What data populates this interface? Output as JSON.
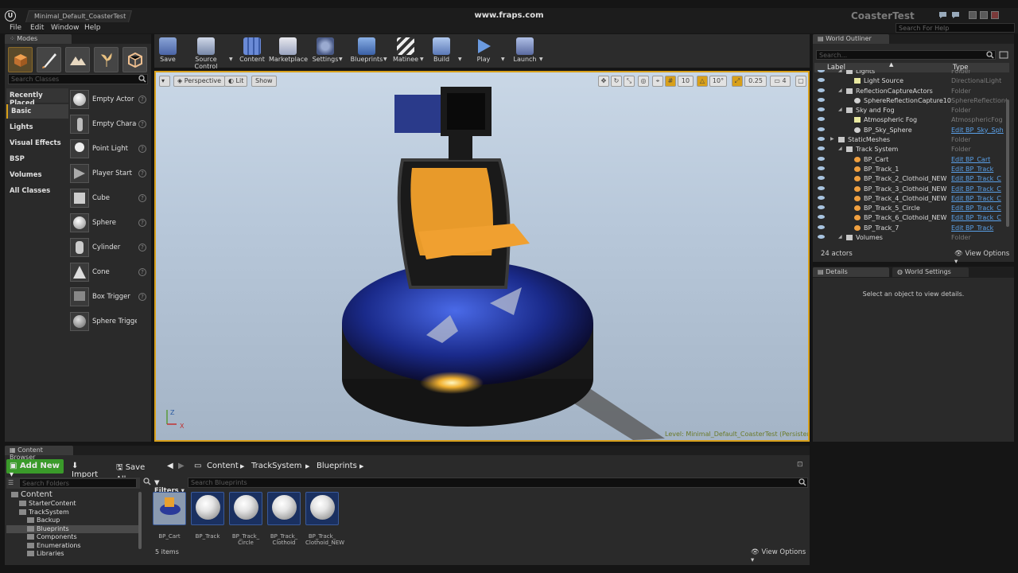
{
  "titlebar": {
    "doc_tab": "Minimal_Default_CoasterTest",
    "overlay": "www.fraps.com",
    "project": "CoasterTest"
  },
  "menu": {
    "items": [
      "File",
      "Edit",
      "Window",
      "Help"
    ],
    "help_search_placeholder": "Search For Help"
  },
  "modes": {
    "tab_label": "Modes",
    "search_placeholder": "Search Classes",
    "categories": [
      "Recently Placed",
      "Basic",
      "Lights",
      "Visual Effects",
      "BSP",
      "Volumes",
      "All Classes"
    ],
    "items": [
      "Empty Actor",
      "Empty Charac",
      "Point Light",
      "Player Start",
      "Cube",
      "Sphere",
      "Cylinder",
      "Cone",
      "Box Trigger",
      "Sphere Trigge"
    ]
  },
  "toolbar": {
    "buttons": [
      "Save",
      "Source Control",
      "Content",
      "Marketplace",
      "Settings",
      "Blueprints",
      "Matinee",
      "Build",
      "Play",
      "Launch"
    ]
  },
  "viewport": {
    "perspective": "Perspective",
    "lit": "Lit",
    "show": "Show",
    "grid_snap": "10",
    "rot_snap": "10°",
    "scale_snap": "0.25",
    "cam_speed": "4",
    "level_label": "Level:  Minimal_Default_CoasterTest (Persistent)",
    "axis_z": "Z",
    "axis_x": "X"
  },
  "outliner": {
    "tab_label": "World Outliner",
    "search_placeholder": "Search...",
    "col_label": "Label",
    "col_type": "Type",
    "rows": [
      {
        "label": "Lights",
        "type": "Folder",
        "indent": 1,
        "kind": "folder",
        "link": false
      },
      {
        "label": "Light Source",
        "type": "DirectionalLight",
        "indent": 2,
        "kind": "light",
        "link": false
      },
      {
        "label": "ReflectionCaptureActors",
        "type": "Folder",
        "indent": 1,
        "kind": "folder",
        "link": false
      },
      {
        "label": "SphereReflectionCapture10",
        "type": "SphereReflectionC",
        "indent": 2,
        "kind": "sphere",
        "link": false
      },
      {
        "label": "Sky and Fog",
        "type": "Folder",
        "indent": 1,
        "kind": "folder",
        "link": false
      },
      {
        "label": "Atmospheric Fog",
        "type": "AtmosphericFog",
        "indent": 2,
        "kind": "light",
        "link": false
      },
      {
        "label": "BP_Sky_Sphere",
        "type": "Edit BP_Sky_Sph",
        "indent": 2,
        "kind": "sphere",
        "link": true
      },
      {
        "label": "StaticMeshes",
        "type": "Folder",
        "indent": 0,
        "kind": "folder",
        "link": false
      },
      {
        "label": "Track System",
        "type": "Folder",
        "indent": 1,
        "kind": "folder",
        "link": false
      },
      {
        "label": "BP_Cart",
        "type": "Edit BP_Cart",
        "indent": 2,
        "kind": "bp",
        "link": true
      },
      {
        "label": "BP_Track_1",
        "type": "Edit BP_Track",
        "indent": 2,
        "kind": "bp",
        "link": true
      },
      {
        "label": "BP_Track_2_Clothoid_NEW",
        "type": "Edit BP_Track_C",
        "indent": 2,
        "kind": "bp",
        "link": true
      },
      {
        "label": "BP_Track_3_Clothoid_NEW",
        "type": "Edit BP_Track_C",
        "indent": 2,
        "kind": "bp",
        "link": true
      },
      {
        "label": "BP_Track_4_Clothoid_NEW",
        "type": "Edit BP_Track_C",
        "indent": 2,
        "kind": "bp",
        "link": true
      },
      {
        "label": "BP_Track_5_Circle",
        "type": "Edit BP_Track_C",
        "indent": 2,
        "kind": "bp",
        "link": true
      },
      {
        "label": "BP_Track_6_Clothoid_NEW",
        "type": "Edit BP_Track_C",
        "indent": 2,
        "kind": "bp",
        "link": true
      },
      {
        "label": "BP_Track_7",
        "type": "Edit BP_Track",
        "indent": 2,
        "kind": "bp",
        "link": true
      },
      {
        "label": "Volumes",
        "type": "Folder",
        "indent": 1,
        "kind": "folder",
        "link": false
      }
    ],
    "actor_count": "24 actors",
    "view_options": "View Options"
  },
  "details": {
    "tab_details": "Details",
    "tab_world_settings": "World Settings",
    "empty_message": "Select an object to view details."
  },
  "content_browser": {
    "tab_label": "Content Browser",
    "add_new": "Add New",
    "import": "Import",
    "save_all": "Save All",
    "path": [
      "Content",
      "TrackSystem",
      "Blueprints"
    ],
    "search_folders_placeholder": "Search Folders",
    "filters": "Filters",
    "search_blueprints_placeholder": "Search Blueprints",
    "tree": [
      {
        "label": "Content",
        "indent": 0,
        "selected": false
      },
      {
        "label": "StarterContent",
        "indent": 1,
        "selected": false
      },
      {
        "label": "TrackSystem",
        "indent": 1,
        "selected": false
      },
      {
        "label": "Backup",
        "indent": 2,
        "selected": false
      },
      {
        "label": "Blueprints",
        "indent": 2,
        "selected": true
      },
      {
        "label": "Components",
        "indent": 2,
        "selected": false
      },
      {
        "label": "Enumerations",
        "indent": 2,
        "selected": false
      },
      {
        "label": "Libraries",
        "indent": 2,
        "selected": false
      }
    ],
    "assets": [
      "BP_Cart",
      "BP_Track",
      "BP_Track_\nCircle",
      "BP_Track_\nClothoid",
      "BP_Track_\nClothoid_NEW"
    ],
    "item_count": "5 items",
    "view_options": "View Options"
  },
  "colors": {
    "accent_orange": "#d8a01a",
    "link_blue": "#5aa0e8",
    "add_new_green": "#3a9a2a"
  }
}
